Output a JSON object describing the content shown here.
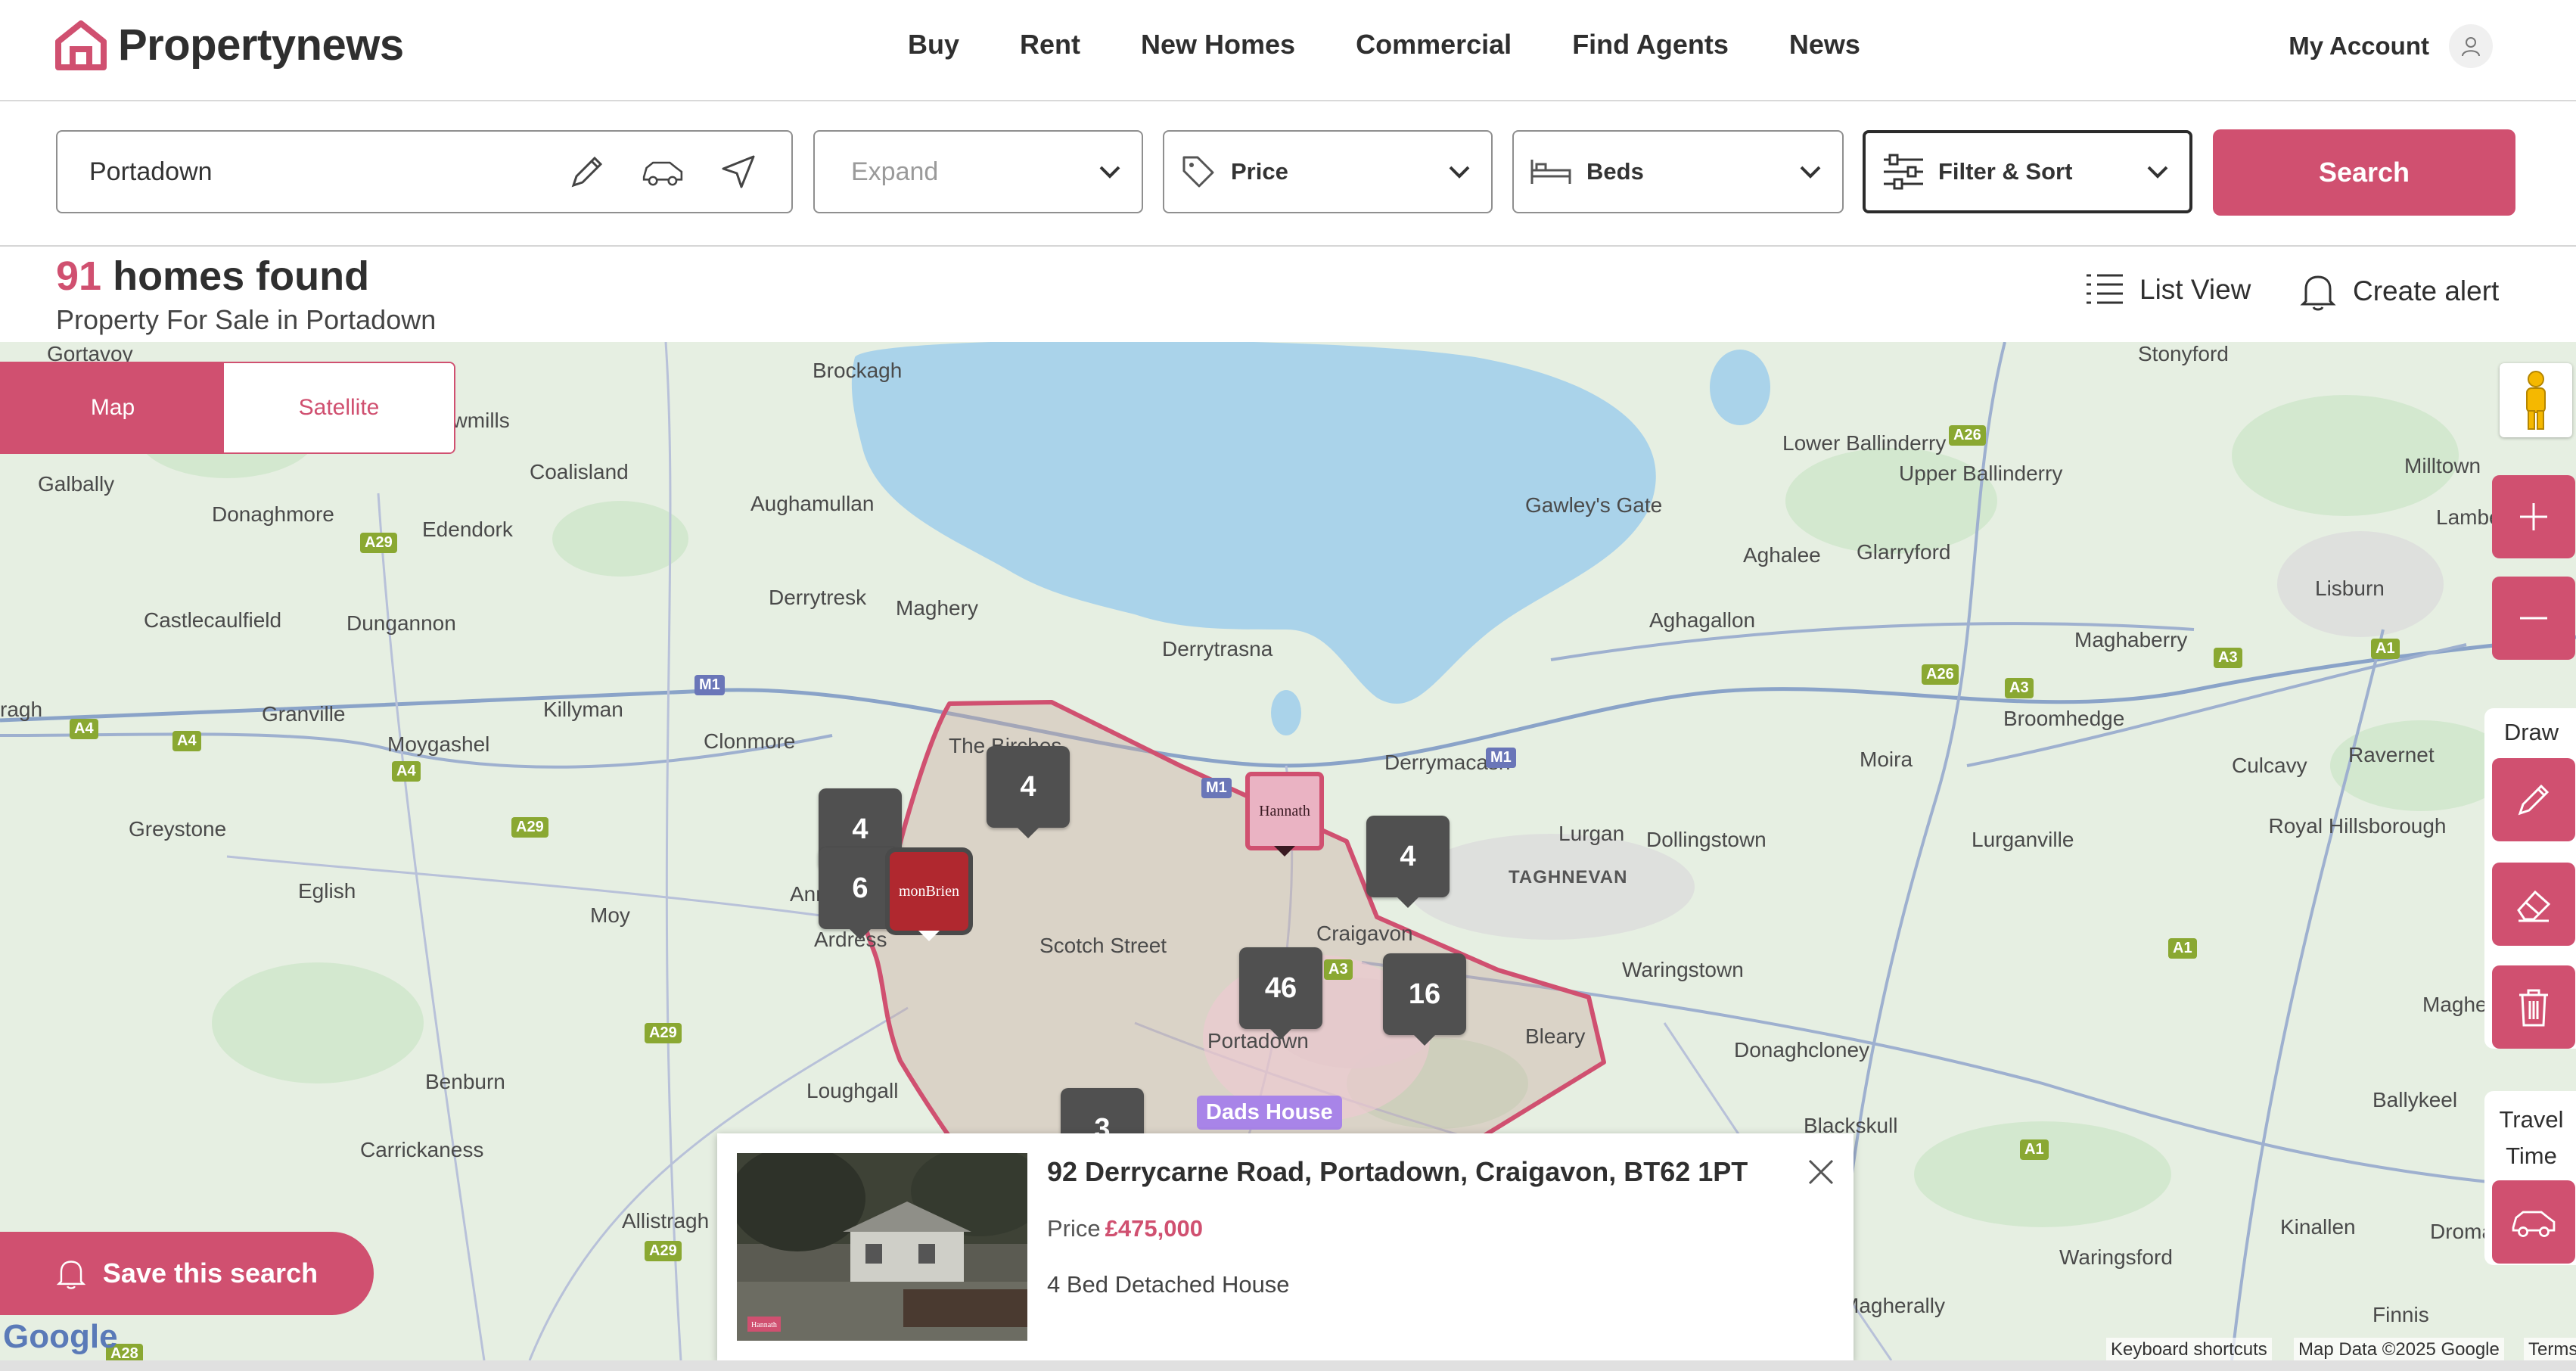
{
  "brand": {
    "name": "Propertynews",
    "accent": "#d05070"
  },
  "nav": {
    "items": [
      "Buy",
      "Rent",
      "New Homes",
      "Commercial",
      "Find Agents",
      "News"
    ]
  },
  "account": {
    "label": "My Account"
  },
  "search": {
    "location": "Portadown",
    "expand": "Expand",
    "price": "Price",
    "beds": "Beds",
    "filter": "Filter & Sort",
    "button": "Search"
  },
  "results": {
    "count": "91",
    "count_suffix": " homes found",
    "subtitle": "Property For Sale in Portadown",
    "list_view": "List View",
    "create_alert": "Create alert"
  },
  "map": {
    "toggle": {
      "map": "Map",
      "satellite": "Satellite"
    },
    "places": [
      "Gortavoy",
      "Brockagh",
      "Stonyford",
      "ewmills",
      "Coalisland",
      "Aughamullan",
      "Lower Ballinderry",
      "Upper Ballinderry",
      "Milltown",
      "Galbally",
      "Donaghmore",
      "Edendork",
      "Gawley's Gate",
      "Aghalee",
      "Glarryford",
      "Lambeg",
      "Derrytresk",
      "Maghery",
      "Lisburn",
      "Castlecaulfield",
      "Dungannon",
      "Derrytrasna",
      "Aghagallon",
      "Maghaberry",
      "Broomhedge",
      "ragh",
      "Granville",
      "Killyman",
      "Clonmore",
      "The Birches",
      "Derrymacash",
      "Moira",
      "Culcavy",
      "Ravernet",
      "Moygashel",
      "Lurgan",
      "Dollingstown",
      "Lurganville",
      "Royal Hillsborough",
      "Greystone",
      "Annag",
      "Eglish",
      "Ardress",
      "Scotch Street",
      "Craigavon",
      "TAGHNEVAN",
      "Moy",
      "Waringstown",
      "Portadown",
      "Bleary",
      "Donaghcloney",
      "Benburn",
      "Loughgall",
      "Ballykeel",
      "Carrickaness",
      "Blackskull",
      "Allistragh",
      "Kinallen",
      "Waringsford",
      "Magherally",
      "Finnis",
      "Maghe",
      "Droma"
    ],
    "road_labels": [
      "A29",
      "A4",
      "A4",
      "A4",
      "A29",
      "A29",
      "A29",
      "A28",
      "A26",
      "A26",
      "A3",
      "A3",
      "A1",
      "A1",
      "A1",
      "A3",
      "M1",
      "M1",
      "M1"
    ],
    "clusters": [
      "4",
      "6",
      "4",
      "4",
      "46",
      "16",
      "3"
    ],
    "agent_pins": [
      "Hannath",
      "monBrien"
    ],
    "custom_pin": "Dads House",
    "draw_label": "Draw",
    "travel_label": "Travel Time",
    "save_search": "Save this search",
    "google": "Google",
    "attribution": [
      "Keyboard shortcuts",
      "Map Data ©2025 Google",
      "Terms"
    ]
  },
  "popup": {
    "title": "92 Derrycarne Road, Portadown, Craigavon, BT62 1PT",
    "price_label": "Price",
    "price": "£475,000",
    "type": "4 Bed Detached House",
    "photo_badge": "Hannath"
  }
}
